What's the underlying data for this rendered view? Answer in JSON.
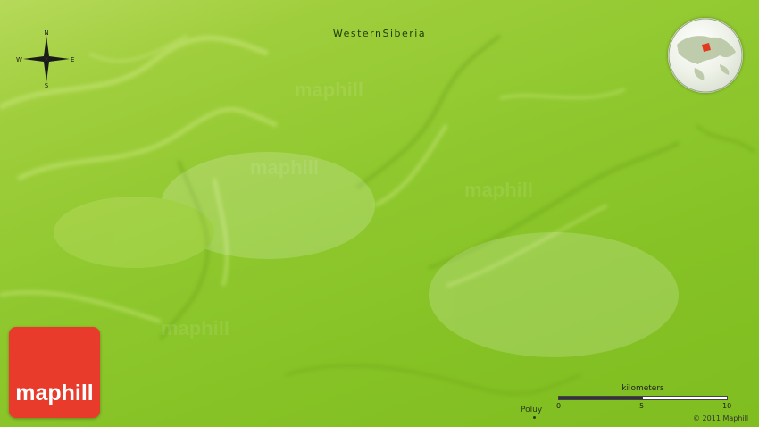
{
  "map": {
    "region_label": "WesternSiberia",
    "terrain_style": "physical relief, yellow-green lowland",
    "background_color": "#8fc82e"
  },
  "compass": {
    "north": "N",
    "south": "S",
    "east": "E",
    "west": "W"
  },
  "locator_globe": {
    "highlight_color": "#e03a20"
  },
  "places": [
    {
      "name": "Poluy"
    }
  ],
  "scale_bar": {
    "unit": "kilometers",
    "ticks": [
      "0",
      "5",
      "10"
    ]
  },
  "branding": {
    "logo_text": "maphill",
    "logo_color": "#e93b2b",
    "copyright": "© 2011 Maphill"
  }
}
